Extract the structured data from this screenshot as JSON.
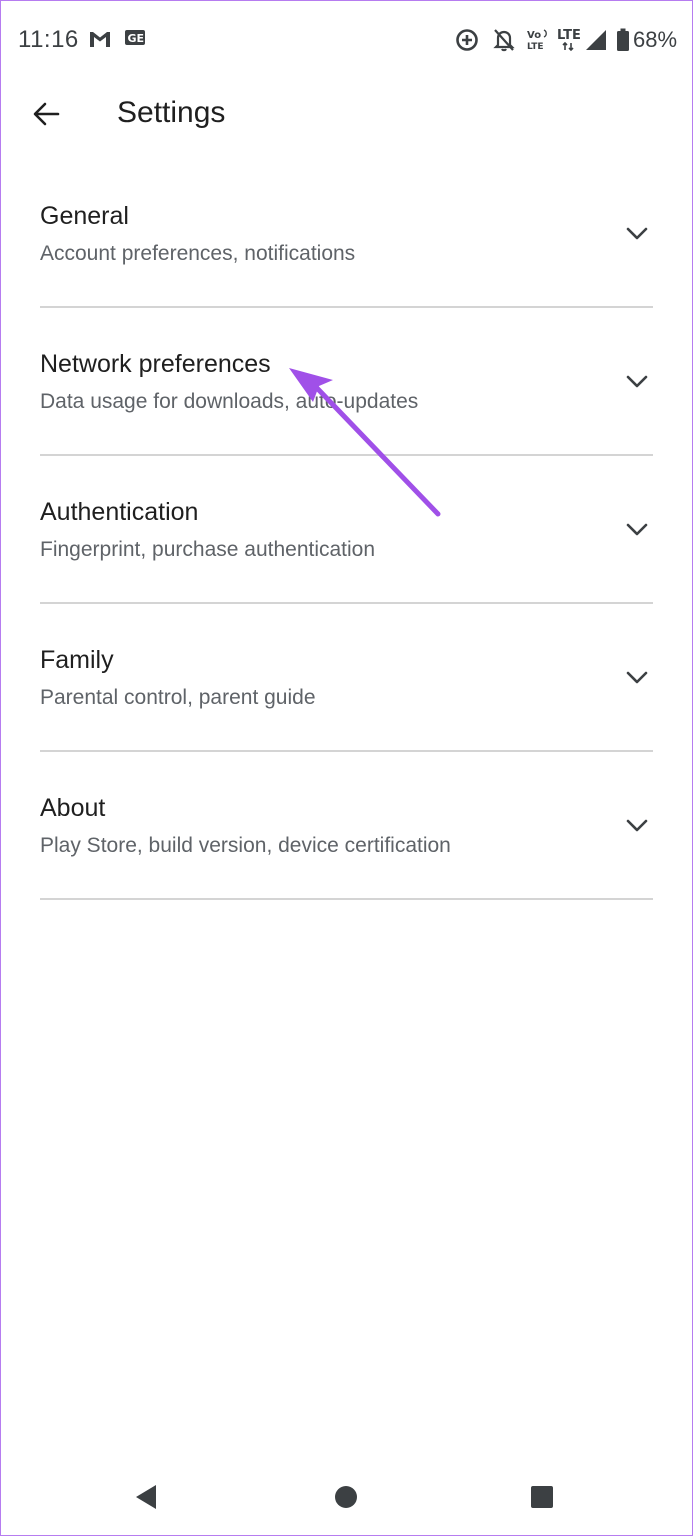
{
  "status_bar": {
    "time": "11:16",
    "battery": "68%",
    "icons_left": [
      "gmail-icon",
      "ge-app-icon"
    ],
    "icons_right": [
      "data-saver-icon",
      "notifications-off-icon",
      "volte-icon",
      "lte-icon",
      "signal-icon",
      "battery-icon"
    ],
    "volte_label_top": "Vo",
    "volte_label_bottom": "LTE",
    "lte_label": "LTE"
  },
  "app_bar": {
    "title": "Settings"
  },
  "settings": {
    "items": [
      {
        "title": "General",
        "subtitle": "Account preferences, notifications"
      },
      {
        "title": "Network preferences",
        "subtitle": "Data usage for downloads, auto-updates"
      },
      {
        "title": "Authentication",
        "subtitle": "Fingerprint, purchase authentication"
      },
      {
        "title": "Family",
        "subtitle": "Parental control, parent guide"
      },
      {
        "title": "About",
        "subtitle": "Play Store, build version, device certification"
      }
    ]
  },
  "annotation": {
    "color": "#a050e8"
  },
  "colors": {
    "frame_border": "#b67cf0",
    "text_primary": "#1f1f1f",
    "text_secondary": "#5f6368",
    "divider": "#d4d4d4"
  }
}
